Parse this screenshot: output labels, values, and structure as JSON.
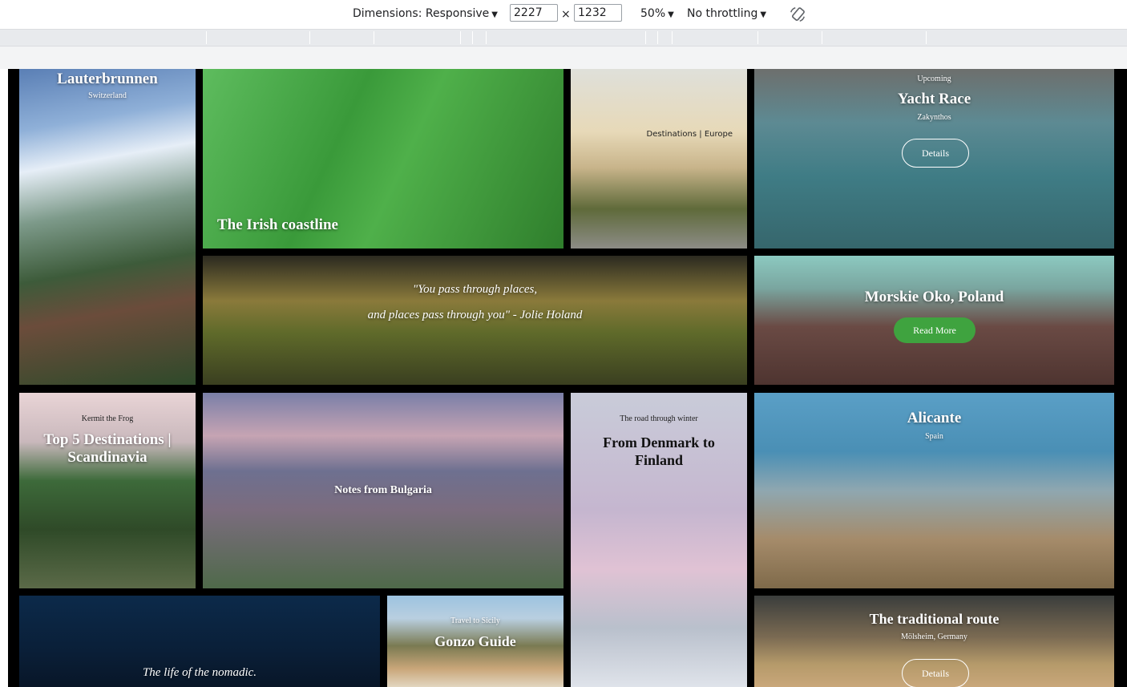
{
  "devtools": {
    "dimensions_label": "Dimensions: Responsive",
    "width": "2227",
    "times": "×",
    "height": "1232",
    "zoom": "50%",
    "throttling": "No throttling",
    "rotate_icon": "rotate-icon"
  },
  "tiles": {
    "lauterbrunnen": {
      "title": "Lauterbrunnen",
      "subtitle": "Switzerland"
    },
    "irish": {
      "title": "The Irish coastline"
    },
    "destinations": {
      "caption": "Destinations | Europe"
    },
    "yacht": {
      "kicker": "Upcoming",
      "title": "Yacht Race",
      "subtitle": "Zakynthos",
      "button": "Details"
    },
    "quote": {
      "line1": "\"You pass through places,",
      "line2": "and places pass through you\" - Jolie Holand"
    },
    "morskie": {
      "title": "Morskie Oko, Poland",
      "button": "Read More"
    },
    "kermit": {
      "kicker": "Kermit the Frog",
      "title": "Top 5 Destinations | Scandinavia"
    },
    "bulgaria": {
      "title": "Notes from Bulgaria"
    },
    "denmark": {
      "kicker": "The road through winter",
      "title": "From Denmark to Finland"
    },
    "alicante": {
      "title": "Alicante",
      "subtitle": "Spain"
    },
    "nomadic": {
      "title": "The life of the nomadic."
    },
    "sicily": {
      "kicker": "Travel to Sicily",
      "title": "Gonzo Guide"
    },
    "traditional": {
      "title": "The traditional route",
      "subtitle": "Mölsheim, Germany",
      "button": "Details"
    }
  },
  "colors": {
    "accent_green": "#3fa33f",
    "devtools_bg": "#ffffff",
    "page_bg": "#000000"
  }
}
